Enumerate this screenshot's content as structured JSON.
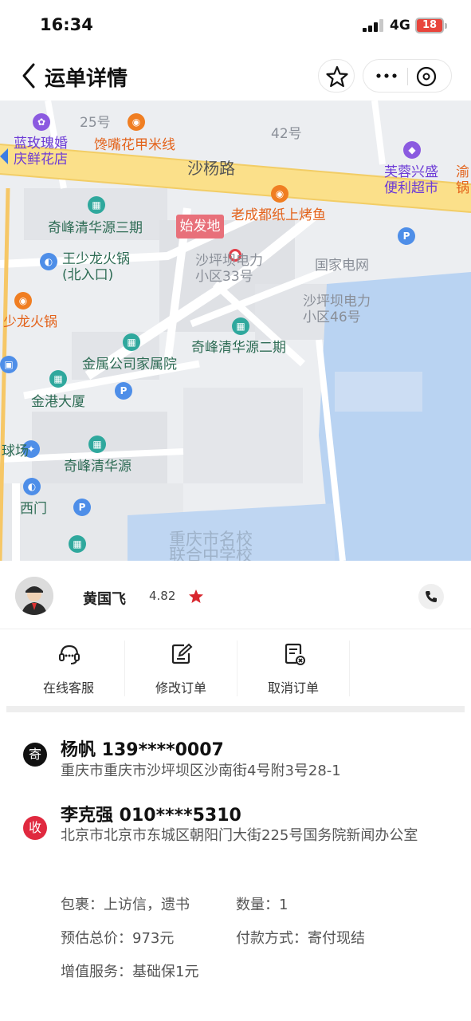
{
  "status_bar": {
    "time": "16:34",
    "network": "4G",
    "battery": "18"
  },
  "nav": {
    "title": "运单详情"
  },
  "map": {
    "labels": {
      "num25": "25号",
      "num42": "42号",
      "flower_shop": "蓝玫瑰婚\n庆鲜花店",
      "chicken_feet": "馋嘴花甲米线",
      "shayang_road": "沙杨路",
      "furong": "芙蓉兴盛\n便利超市",
      "yu_guo": "渝\n锅",
      "laochengdu": "老成都纸上烤鱼",
      "qifeng3": "奇峰清华源三期",
      "start_tag": "始发地",
      "power33": "沙坪坝电力\n小区33号",
      "wang_hotpot": "王少龙火锅\n(北入口)",
      "state_grid": "国家电网",
      "power46": "沙坪坝电力\n小区46号",
      "shaolong_hotpot": "少龙火锅",
      "qifeng2": "奇峰清华源二期",
      "metal_company": "金属公司家属院",
      "jingang": "金港大厦",
      "qifeng": "奇峰清华源",
      "chang": "球场",
      "west_gate": "西门",
      "school": "重庆市名校\n联合中学校"
    }
  },
  "courier": {
    "name": "黄国飞",
    "rating": "4.82"
  },
  "actions": [
    {
      "label": "在线客服"
    },
    {
      "label": "修改订单"
    },
    {
      "label": "取消订单"
    }
  ],
  "order": {
    "sender": {
      "badge": "寄",
      "name_phone": "杨帆 139****0007",
      "address": "重庆市重庆市沙坪坝区沙南街4号附3号28-1"
    },
    "receiver": {
      "badge": "收",
      "name_phone": "李克强 010****5310",
      "address": "北京市北京市东城区朝阳门大街225号国务院新闻办公室"
    },
    "parcel": "包裹：上访信，遗书",
    "quantity": "数量：1",
    "est_price": "预估总价：973元",
    "payment": "付款方式：寄付现结",
    "service": "增值服务：基础保1元"
  },
  "colors": {
    "accent_red": "#e0293f",
    "road_yellow": "#fbe08a",
    "water_blue": "#b8d2f3"
  }
}
